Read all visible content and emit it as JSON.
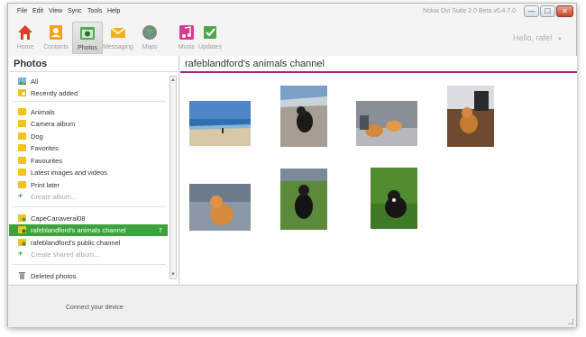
{
  "menu": [
    "File",
    "Edit",
    "View",
    "Sync",
    "Tools",
    "Help"
  ],
  "app_title": "Nokia Ovi Suite 2.0 Beta v0.4.7.0",
  "window_buttons": {
    "minimize": "—",
    "maximize": "☐",
    "close": "✕"
  },
  "toolbar": [
    {
      "label": "Home",
      "icon": "house-icon"
    },
    {
      "label": "Contacts",
      "icon": "contacts-icon"
    },
    {
      "label": "Photos",
      "icon": "camera-icon"
    },
    {
      "label": "Messaging",
      "icon": "envelope-icon"
    },
    {
      "label": "Maps",
      "icon": "globe-icon"
    },
    {
      "label": "Music",
      "icon": "music-icon"
    },
    {
      "label": "Updates",
      "icon": "updates-icon"
    }
  ],
  "user": {
    "greeting": "Hello, rafe!",
    "dropdown": "▼"
  },
  "sidebar": {
    "title": "Photos",
    "items": [
      {
        "label": "All",
        "icon": "photo-icon"
      },
      {
        "label": "Recently added",
        "icon": "recent-icon"
      },
      {
        "label": "Animals",
        "icon": "folder-icon"
      },
      {
        "label": "Camera album",
        "icon": "folder-icon"
      },
      {
        "label": "Dog",
        "icon": "folder-icon"
      },
      {
        "label": "Favorites",
        "icon": "folder-icon"
      },
      {
        "label": "Favourites",
        "icon": "folder-icon"
      },
      {
        "label": "Latest images and videos",
        "icon": "folder-icon"
      },
      {
        "label": "Print later",
        "icon": "folder-icon"
      },
      {
        "label": "Create album...",
        "icon": "plus-icon"
      },
      {
        "label": "CapeCanaveral08",
        "icon": "shared-folder-icon"
      },
      {
        "label": "rafeblandford's animals channel",
        "icon": "shared-folder-icon",
        "count": "7",
        "selected": true
      },
      {
        "label": "rafeblandford's public channel",
        "icon": "shared-folder-icon"
      },
      {
        "label": "Create shared album...",
        "icon": "plus-icon"
      },
      {
        "label": "Deleted photos",
        "icon": "trash-icon"
      }
    ]
  },
  "main": {
    "title": "rafeblandford's animals channel"
  },
  "status": {
    "text": "Connect your device"
  },
  "colors": {
    "accent": "#b0247a",
    "selected": "#3aa33a",
    "folder": "#f2c31d"
  }
}
